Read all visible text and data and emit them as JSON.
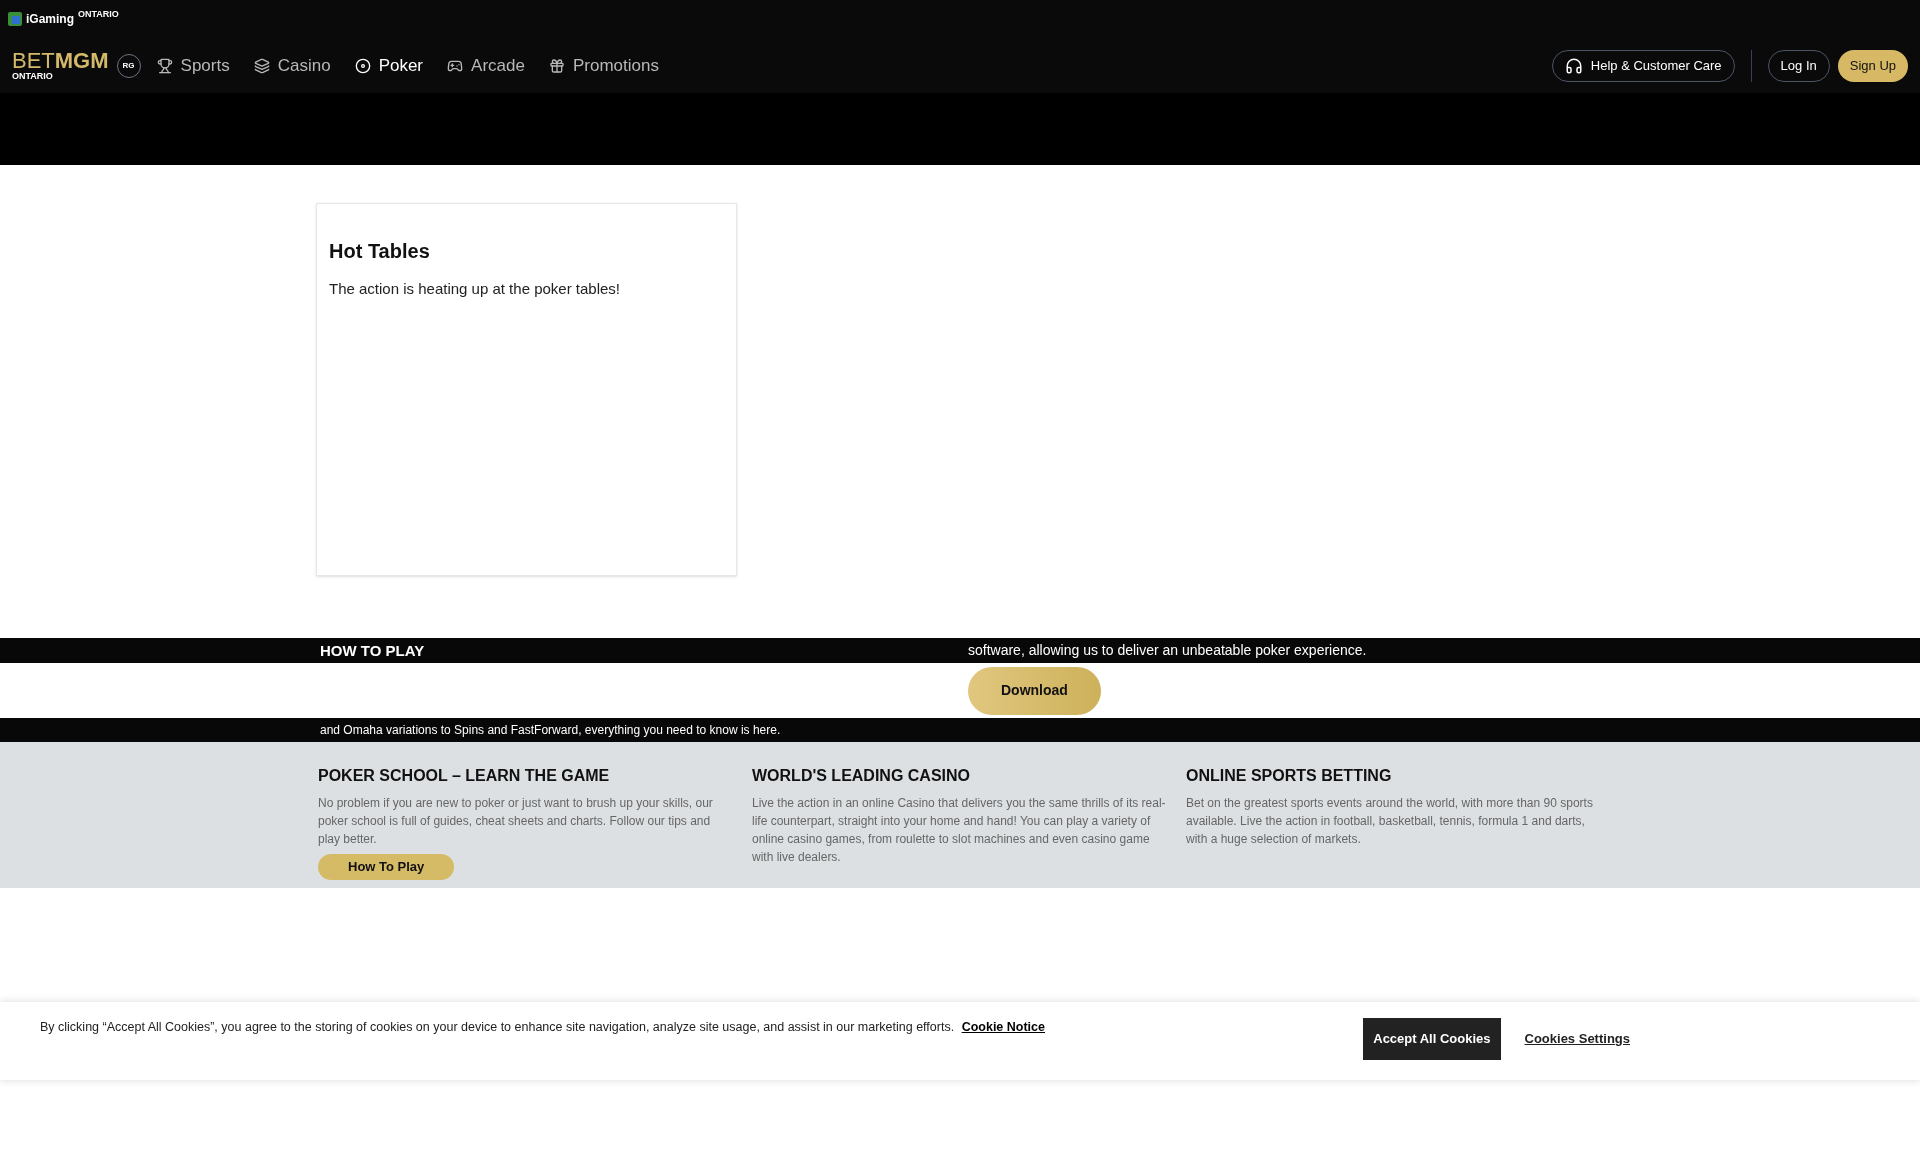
{
  "top_logo": {
    "brand": "iGaming",
    "region": "ONTARIO"
  },
  "brand": {
    "name_light": "BET",
    "name_bold": "MGM",
    "region": "ONTARIO",
    "badge": "RG"
  },
  "nav": [
    {
      "label": "Sports",
      "kind": "trophy",
      "selected": false
    },
    {
      "label": "Casino",
      "kind": "cards",
      "selected": false
    },
    {
      "label": "Poker",
      "kind": "chip",
      "selected": true
    },
    {
      "label": "Arcade",
      "kind": "slot",
      "selected": false
    },
    {
      "label": "Promotions",
      "kind": "gift",
      "selected": false
    }
  ],
  "header_actions": {
    "help": "Help & Customer Care",
    "login": "Log In",
    "signup": "Sign Up"
  },
  "card": {
    "title": "Hot Tables",
    "text": "The action is heating up at the poker tables!"
  },
  "how_to_play": {
    "heading": "HOW TO PLAY",
    "text": "and Omaha variations to Spins and FastForward, everything you need to know is here.",
    "button": "How To Play"
  },
  "download": {
    "text": "software, allowing us to deliver an unbeatable poker experience.",
    "button": "Download"
  },
  "features": [
    {
      "title": "POKER SCHOOL – LEARN THE GAME",
      "text": "No problem if you are new to poker or just want to brush up your skills, our poker school is full of guides, cheat sheets and charts. Follow our tips and play better."
    },
    {
      "title": "WORLD'S LEADING CASINO",
      "text": "Live the action in an online Casino that delivers you the same thrills of its real-life counterpart, straight into your home and hand! You can play a variety of online casino games, from roulette to slot machines and even casino game with live dealers."
    },
    {
      "title": "ONLINE SPORTS BETTING",
      "text": "Bet on the greatest sports events around the world, with more than 90 sports available. Live the action in football, basketball, tennis, formula 1 and darts, with a huge selection of markets."
    }
  ],
  "cookie_banner": {
    "text": "By clicking “Accept All Cookies”, you agree to the storing of cookies on your device to enhance site navigation, analyze site usage, and assist in our marketing efforts.",
    "notice_link": "Cookie Notice",
    "accept": "Accept All Cookies",
    "settings": "Cookies Settings"
  }
}
